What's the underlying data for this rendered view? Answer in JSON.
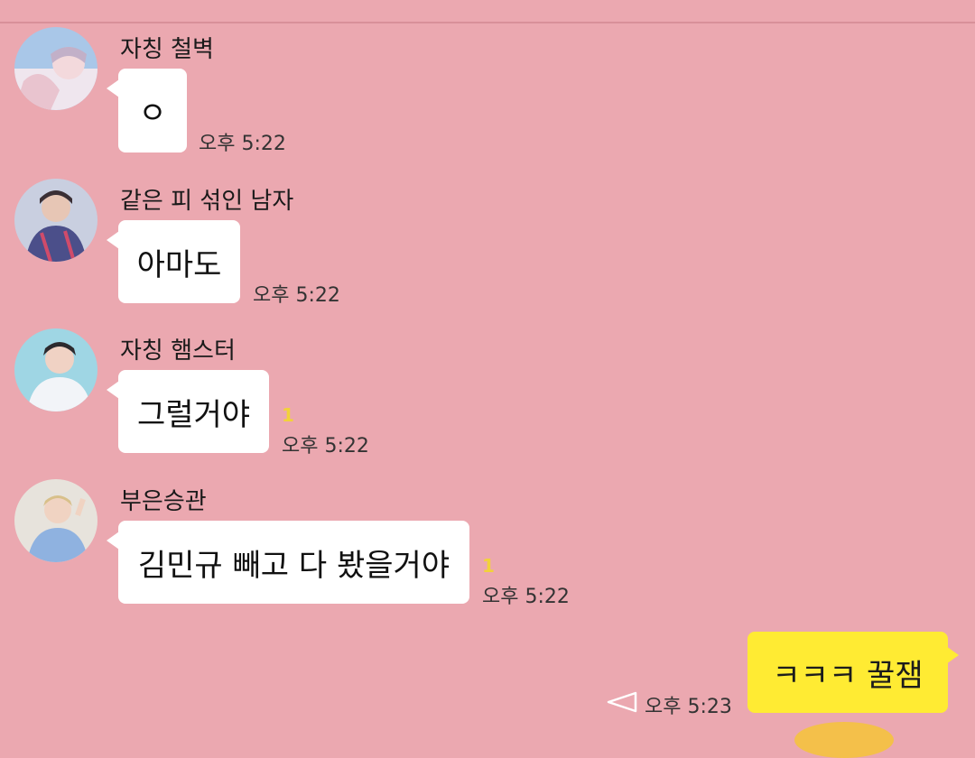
{
  "messages": [
    {
      "sender": "자칭 철벽",
      "text": "ㅇ",
      "time": "오후 5:22",
      "unread": ""
    },
    {
      "sender": "같은 피 섞인 남자",
      "text": "아마도",
      "time": "오후 5:22",
      "unread": ""
    },
    {
      "sender": "자칭 햄스터",
      "text": "그럴거야",
      "time": "오후 5:22",
      "unread": "1"
    },
    {
      "sender": "부은승관",
      "text": "김민규 빼고 다 봤을거야",
      "time": "오후 5:22",
      "unread": "1"
    }
  ],
  "my_message": {
    "text": "ㅋㅋㅋ 꿀잼",
    "time": "오후 5:23"
  },
  "colors": {
    "background": "#eba8b0",
    "bubble": "#ffffff",
    "my_bubble": "#ffeb33",
    "unread": "#f2d23a"
  },
  "icons": {
    "status": "send-status-icon"
  }
}
